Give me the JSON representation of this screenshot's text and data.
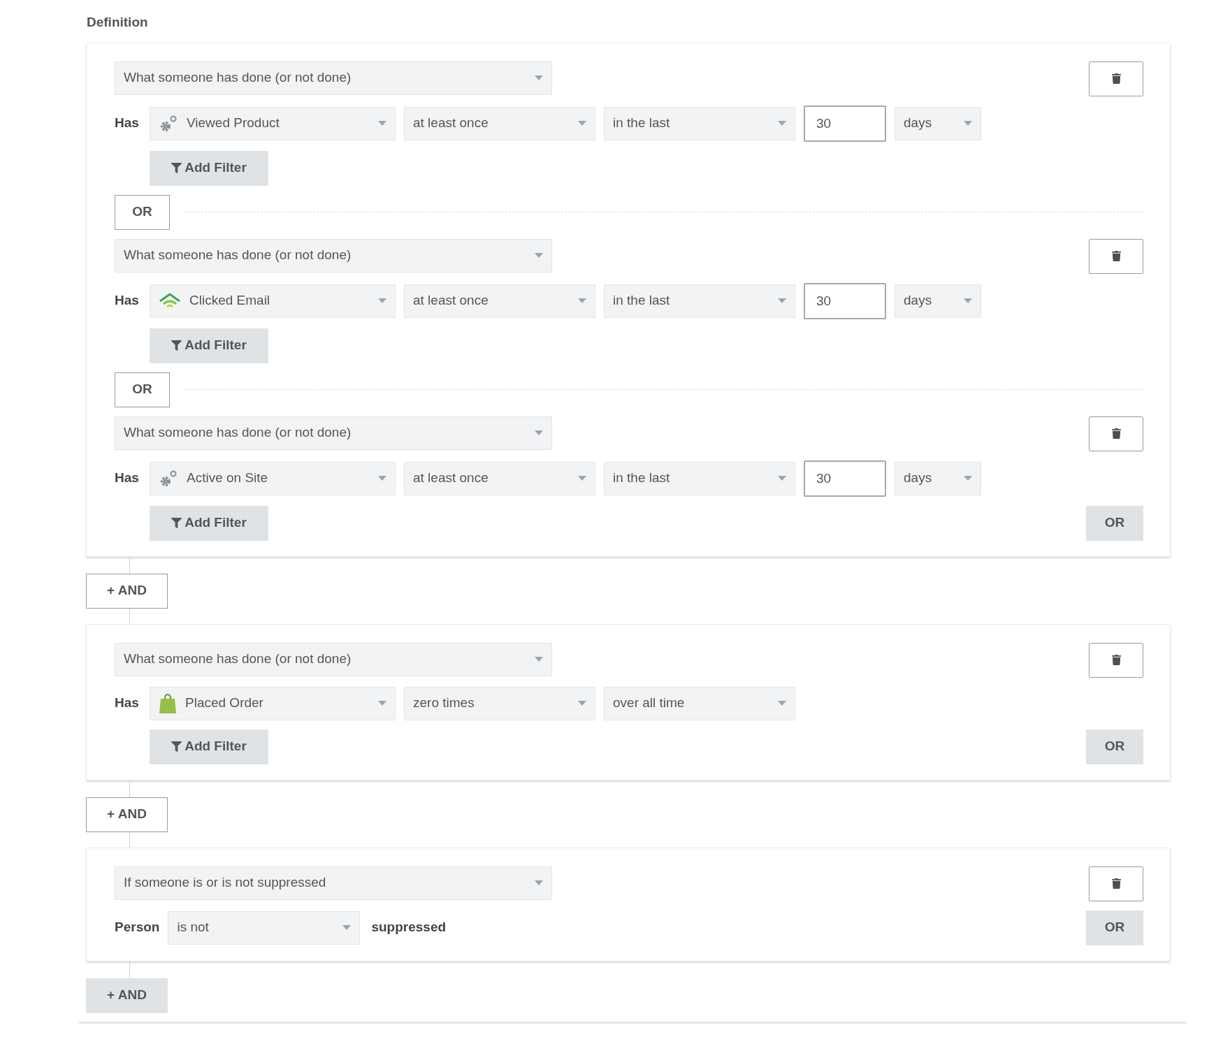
{
  "title": "Definition",
  "groups": [
    {
      "conditions": [
        {
          "kind": "event",
          "type": "What someone has done (or not done)",
          "label": "Has",
          "metric": {
            "name": "Viewed Product",
            "kind": "gears"
          },
          "frequency": "at least once",
          "timeframe": "in the last",
          "count": "30",
          "unit": "days",
          "filter": "Add Filter"
        },
        {
          "kind": "event",
          "separator": "OR",
          "type": "What someone has done (or not done)",
          "label": "Has",
          "metric": {
            "name": "Clicked Email",
            "kind": "signal"
          },
          "frequency": "at least once",
          "timeframe": "in the last",
          "count": "30",
          "unit": "days",
          "filter": "Add Filter"
        },
        {
          "kind": "event",
          "separator": "OR",
          "type": "What someone has done (or not done)",
          "label": "Has",
          "metric": {
            "name": "Active on Site",
            "kind": "gears"
          },
          "frequency": "at least once",
          "timeframe": "in the last",
          "count": "30",
          "unit": "days",
          "filter": "Add Filter"
        }
      ],
      "or_button": "OR",
      "and_button": {
        "label": "+ AND",
        "highlighted": false
      }
    },
    {
      "conditions": [
        {
          "kind": "event",
          "type": "What someone has done (or not done)",
          "label": "Has",
          "metric": {
            "name": "Placed Order",
            "kind": "bag"
          },
          "frequency": "zero times",
          "timeframe": "over all time",
          "filter": "Add Filter"
        }
      ],
      "or_button": "OR",
      "and_button": {
        "label": "+ AND",
        "highlighted": false
      }
    },
    {
      "conditions": [
        {
          "kind": "suppression",
          "type": "If someone is or is not suppressed",
          "label": "Person",
          "operator": "is not",
          "suffix": "suppressed"
        }
      ],
      "or_button": "OR",
      "and_button": {
        "label": "+ AND",
        "highlighted": true
      }
    }
  ]
}
